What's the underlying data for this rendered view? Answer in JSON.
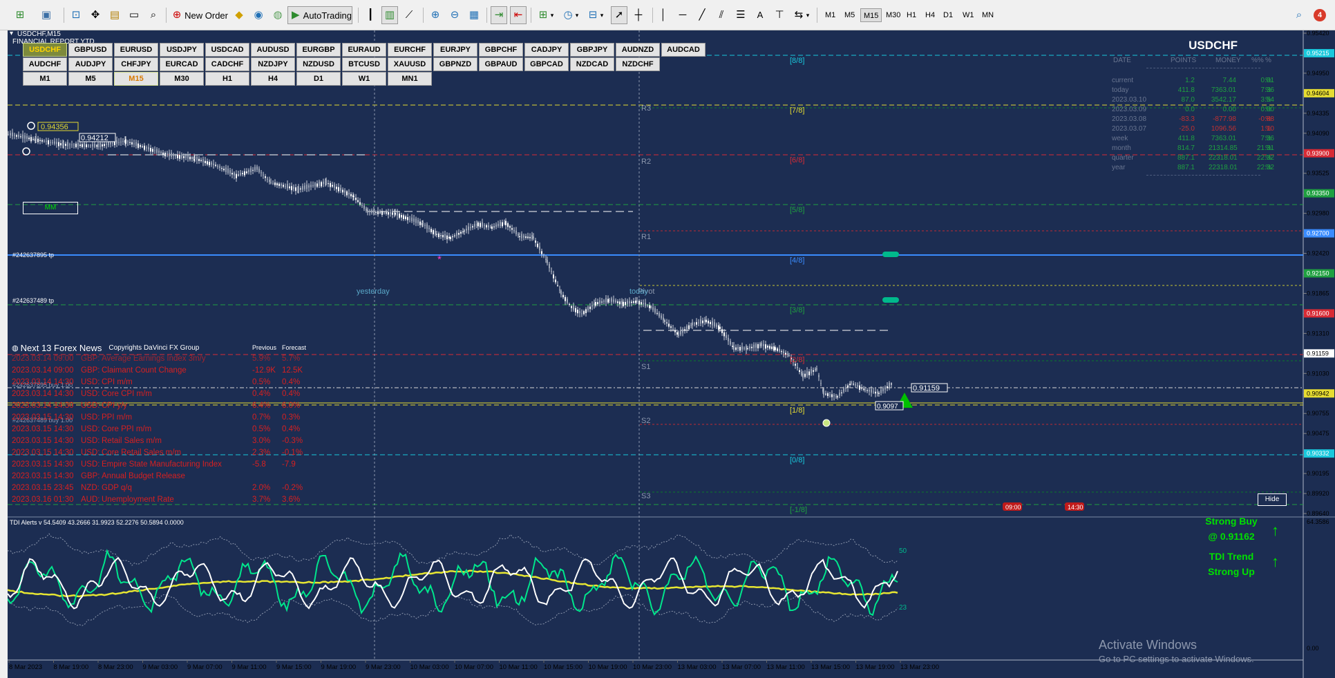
{
  "toolbar": {
    "new_order_label": "New Order",
    "autotrading_label": "AutoTrading",
    "timeframes": [
      "M1",
      "M5",
      "M15",
      "M30",
      "H1",
      "H4",
      "D1",
      "W1",
      "MN"
    ],
    "active_timeframe": "M15",
    "search_icon": "search-icon",
    "notification_count": "4"
  },
  "chart": {
    "symbol_label": "USDCHF,M15",
    "report_label": "FINANCIAL REPORT YTD",
    "symbol_big": "USDCHF",
    "pairs_row1": [
      "USDCHF",
      "GBPUSD",
      "EURUSD",
      "USDJPY",
      "USDCAD",
      "AUDUSD",
      "EURGBP",
      "EURAUD",
      "EURCHF",
      "EURJPY",
      "GBPCHF",
      "CADJPY",
      "GBPJPY",
      "AUDNZD",
      "AUDCAD"
    ],
    "pairs_row2": [
      "AUDCHF",
      "AUDJPY",
      "CHFJPY",
      "EURCAD",
      "CADCHF",
      "NZDJPY",
      "NZDUSD",
      "BTCUSD",
      "XAUUSD",
      "GBPNZD",
      "GBPAUD",
      "GBPCAD",
      "NZDCAD",
      "NZDCHF"
    ],
    "timeframe_buttons": [
      "M1",
      "M5",
      "M15",
      "M30",
      "H1",
      "H4",
      "D1",
      "W1",
      "MN1"
    ],
    "active_pair": "USDCHF",
    "active_tf_button": "M15",
    "mm_label": "MM",
    "price_tags": {
      "high": "0.94356",
      "prev": "0.94212",
      "current": "0.91159",
      "low": "0.9097"
    },
    "order_labels": [
      "#242637895 tp",
      "#242637489 tp",
      "#242637895 buy 1.00",
      "#242637489 buy 1.00"
    ],
    "pivot_labels": [
      "R3",
      "R2",
      "R1",
      "Pivot",
      "S1",
      "S2",
      "S3"
    ],
    "day_labels": [
      "yesterday",
      "today"
    ],
    "murrey_labels": [
      "[8/8]",
      "[7/8]",
      "[6/8]",
      "[5/8]",
      "[4/8]",
      "[3/8]",
      "[2/8]",
      "[1/8]",
      "[0/8]",
      "[-1/8]"
    ],
    "hide_label": "Hide",
    "time_markers": [
      "09:00",
      "14:30"
    ],
    "activate_windows": "Activate Windows",
    "activate_windows_sub": "Go to PC settings to activate Windows.",
    "colors": {
      "background": "#1c2d52",
      "buy": "#00c000",
      "accent": "#ffd400"
    }
  },
  "report": {
    "headers": [
      "DATE",
      "POINTS",
      "MONEY",
      "%%",
      "%"
    ],
    "rows": [
      {
        "label": "current",
        "points": "1.2",
        "money": "7.44",
        "pct": "0.01",
        "sym": "%"
      },
      {
        "label": "today",
        "points": "411.8",
        "money": "7363.01",
        "pct": "7.36",
        "sym": "%"
      },
      {
        "label": "2023.03.10",
        "points": "87.0",
        "money": "3542.17",
        "pct": "3.54",
        "sym": "%"
      },
      {
        "label": "2023.03.09",
        "points": "0.0",
        "money": "0.00",
        "pct": "0.00",
        "sym": "%"
      },
      {
        "label": "2023.03.08",
        "points": "-83.3",
        "money": "-877.98",
        "pct": "-0.88",
        "sym": "%"
      },
      {
        "label": "2023.03.07",
        "points": "-25.0",
        "money": "1096.56",
        "pct": "1.10",
        "sym": "%"
      },
      {
        "label": "week",
        "points": "411.8",
        "money": "7363.01",
        "pct": "7.36",
        "sym": "%"
      },
      {
        "label": "month",
        "points": "814.7",
        "money": "21314.85",
        "pct": "21.31",
        "sym": "%"
      },
      {
        "label": "quarter",
        "points": "887.1",
        "money": "22318.01",
        "pct": "22.32",
        "sym": "%"
      },
      {
        "label": "year",
        "points": "887.1",
        "money": "22318.01",
        "pct": "22.32",
        "sym": "%"
      }
    ]
  },
  "news": {
    "title": "Next 13 Forex News",
    "copyright": "Copyrights DaVinci FX Group",
    "col_prev": "Previous",
    "col_fcst": "Forecast",
    "items": [
      {
        "time": "2023.03.14 09:00",
        "cur": "GBP:",
        "event": "Average Earnings Index 3m/y",
        "prev": "5.9%",
        "fcst": "5.7%"
      },
      {
        "time": "2023.03.14 09:00",
        "cur": "GBP:",
        "event": "Claimant Count Change",
        "prev": "-12.9K",
        "fcst": "12.5K"
      },
      {
        "time": "2023.03.14 14:30",
        "cur": "USD:",
        "event": "CPI m/m",
        "prev": "0.5%",
        "fcst": "0.4%"
      },
      {
        "time": "2023.03.14 14:30",
        "cur": "USD:",
        "event": "Core CPI m/m",
        "prev": "0.4%",
        "fcst": "0.4%"
      },
      {
        "time": "2023.03.14 14:30",
        "cur": "USD:",
        "event": "CPI y/y",
        "prev": "6.4%",
        "fcst": "6.0%"
      },
      {
        "time": "2023.03.15 14:30",
        "cur": "USD:",
        "event": "PPI m/m",
        "prev": "0.7%",
        "fcst": "0.3%"
      },
      {
        "time": "2023.03.15 14:30",
        "cur": "USD:",
        "event": "Core PPI m/m",
        "prev": "0.5%",
        "fcst": "0.4%"
      },
      {
        "time": "2023.03.15 14:30",
        "cur": "USD:",
        "event": "Retail Sales m/m",
        "prev": "3.0%",
        "fcst": "-0.3%"
      },
      {
        "time": "2023.03.15 14:30",
        "cur": "USD:",
        "event": "Core Retail Sales m/m",
        "prev": "2.3%",
        "fcst": "-0.1%"
      },
      {
        "time": "2023.03.15 14:30",
        "cur": "USD:",
        "event": "Empire State Manufacturing Index",
        "prev": "-5.8",
        "fcst": "-7.9"
      },
      {
        "time": "2023.03.15 14:30",
        "cur": "GBP:",
        "event": "Annual Budget Release",
        "prev": "",
        "fcst": ""
      },
      {
        "time": "2023.03.15 23:45",
        "cur": "NZD:",
        "event": "GDP q/q",
        "prev": "2.0%",
        "fcst": "-0.2%"
      },
      {
        "time": "2023.03.16 01:30",
        "cur": "AUD:",
        "event": "Unemployment Rate",
        "prev": "3.7%",
        "fcst": "3.6%"
      }
    ]
  },
  "indicator": {
    "label": "TDI Alerts v 54.5409 43.2666 31.9923 52.2276 50.5894 0.0000",
    "level_hi": "50",
    "level_lo": "23",
    "signal_line1": "Strong Buy",
    "signal_line2": "@ 0.91162",
    "trend_line1": "TDI Trend",
    "trend_line2": "Strong Up",
    "scale_top": "64.3586",
    "scale_bottom": "0.00"
  },
  "price_axis": [
    "0.95420",
    "0.95215",
    "0.94950",
    "0.94604",
    "0.94335",
    "0.94090",
    "0.93900",
    "0.93525",
    "0.93350",
    "0.92980",
    "0.92700",
    "0.92420",
    "0.92150",
    "0.91865",
    "0.91600",
    "0.91310",
    "0.91159",
    "0.91030",
    "0.90942",
    "0.90755",
    "0.90475",
    "0.90332",
    "0.90195",
    "0.89920",
    "0.89640"
  ],
  "time_axis": [
    "8 Mar 2023",
    "8 Mar 19:00",
    "8 Mar 23:00",
    "9 Mar 03:00",
    "9 Mar 07:00",
    "9 Mar 11:00",
    "9 Mar 15:00",
    "9 Mar 19:00",
    "9 Mar 23:00",
    "10 Mar 03:00",
    "10 Mar 07:00",
    "10 Mar 11:00",
    "10 Mar 15:00",
    "10 Mar 19:00",
    "10 Mar 23:00",
    "13 Mar 03:00",
    "13 Mar 07:00",
    "13 Mar 11:00",
    "13 Mar 15:00",
    "13 Mar 19:00",
    "13 Mar 23:00"
  ]
}
